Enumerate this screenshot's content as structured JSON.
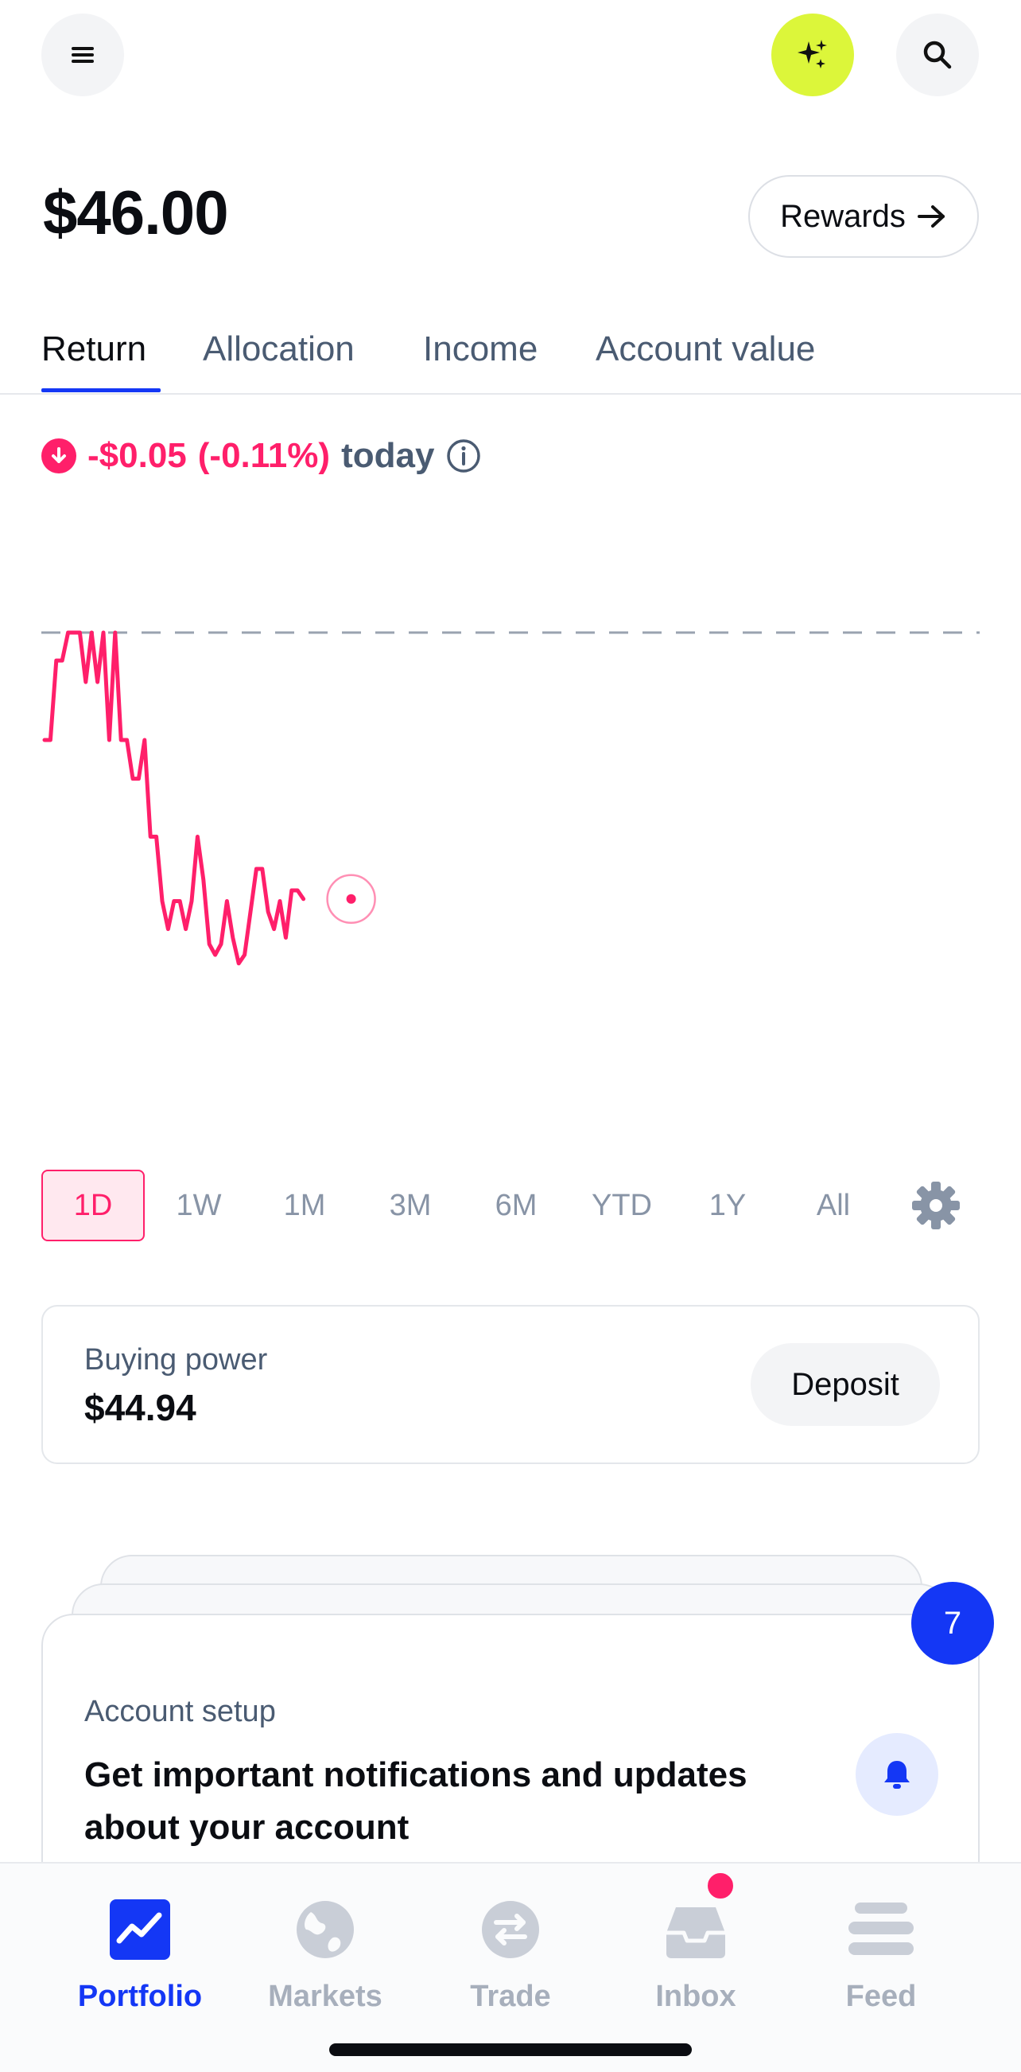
{
  "header": {
    "menu_icon": "hamburger-icon",
    "ai_icon": "sparkle-icon",
    "search_icon": "search-icon",
    "ai_color": "#dcf63a"
  },
  "balance": {
    "value": "$46.00",
    "rewards_label": "Rewards",
    "rewards_icon": "arrow-right-icon"
  },
  "tabs": [
    {
      "label": "Return",
      "active": true
    },
    {
      "label": "Allocation",
      "active": false
    },
    {
      "label": "Income",
      "active": false
    },
    {
      "label": "Account value",
      "active": false
    }
  ],
  "change": {
    "amount": "-$0.05",
    "percent": "(-0.11%)",
    "period": "today",
    "icon": "down-arrow-icon",
    "info_icon": "info-icon",
    "color": "#ff1f6a"
  },
  "chart_data": {
    "type": "line",
    "line_color": "#ff1f6a",
    "baseline_style": "dashed",
    "points": [
      0.0,
      0.0,
      0.37,
      0.37,
      0.5,
      0.5,
      0.5,
      0.27,
      0.5,
      0.27,
      0.5,
      0.0,
      0.5,
      0.0,
      0.0,
      -0.18,
      -0.18,
      0.0,
      -0.45,
      -0.45,
      -0.75,
      -0.88,
      -0.75,
      -0.75,
      -0.88,
      -0.75,
      -0.45,
      -0.65,
      -0.95,
      -1.0,
      -0.95,
      -0.75,
      -0.92,
      -1.04,
      -1.0,
      -0.8,
      -0.6,
      -0.6,
      -0.8,
      -0.88,
      -0.75,
      -0.92,
      -0.7,
      -0.7,
      -0.74
    ],
    "baseline": 0.5
  },
  "ranges": [
    {
      "label": "1D",
      "active": true
    },
    {
      "label": "1W",
      "active": false
    },
    {
      "label": "1M",
      "active": false
    },
    {
      "label": "3M",
      "active": false
    },
    {
      "label": "6M",
      "active": false
    },
    {
      "label": "YTD",
      "active": false
    },
    {
      "label": "1Y",
      "active": false
    },
    {
      "label": "All",
      "active": false
    }
  ],
  "range_settings_icon": "gear-icon",
  "buying_power": {
    "label": "Buying power",
    "value": "$44.94",
    "deposit_label": "Deposit"
  },
  "setup_card": {
    "label": "Account setup",
    "text": "Get important notifications and updates about your account",
    "count": "7",
    "icon": "bell-icon"
  },
  "nav": [
    {
      "label": "Portfolio",
      "icon": "portfolio-chart-icon",
      "active": true
    },
    {
      "label": "Markets",
      "icon": "globe-icon",
      "active": false
    },
    {
      "label": "Trade",
      "icon": "swap-arrows-icon",
      "active": false
    },
    {
      "label": "Inbox",
      "icon": "inbox-tray-icon",
      "active": false
    },
    {
      "label": "Feed",
      "icon": "feed-lines-icon",
      "active": false
    }
  ]
}
